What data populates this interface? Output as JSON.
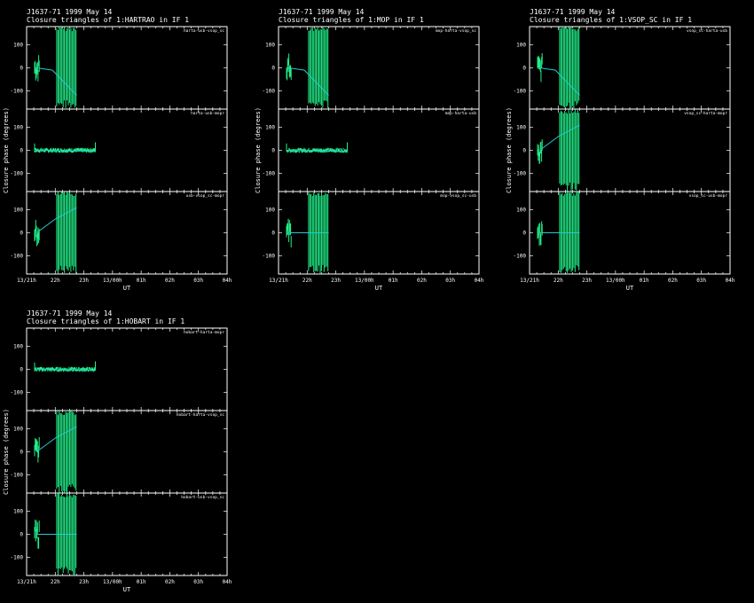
{
  "source": "J1637-71",
  "date": "1999 May 14",
  "colors": {
    "background": "#000000",
    "data": "#22ee88",
    "model": "#22cccc",
    "axes": "#ffffff"
  },
  "chart_data": [
    {
      "type": "scatter",
      "title": "Closure triangles of 1:HARTRAO in IF 1",
      "xlabel": "UT",
      "ylabel": "Closure phase (degrees)",
      "xticks": [
        "13/21h",
        "22h",
        "23h",
        "13/00h",
        "01h",
        "02h",
        "03h",
        "04h"
      ],
      "yticks": [
        -100,
        0,
        100
      ],
      "ylim": [
        -180,
        180
      ],
      "panels": [
        {
          "label": "harta-usb-vsop_sc",
          "model": [
            [
              0.35,
              0
            ],
            [
              0.9,
              -10
            ],
            [
              1.75,
              -120
            ]
          ],
          "data_segments": [
            [
              0.28,
              0.45,
              "noisy"
            ],
            [
              1.05,
              1.75,
              "wrap"
            ]
          ]
        },
        {
          "label": "harta-usb-mopr",
          "model": [
            [
              0.35,
              0
            ],
            [
              2.4,
              -5
            ]
          ],
          "data_segments": [
            [
              0.28,
              2.4,
              "flat"
            ]
          ]
        },
        {
          "label": "usb-vsop_sc-mopr",
          "model": [
            [
              0.35,
              0
            ],
            [
              1.0,
              60
            ],
            [
              1.75,
              110
            ]
          ],
          "data_segments": [
            [
              0.28,
              0.45,
              "noisy"
            ],
            [
              1.05,
              1.75,
              "wrap"
            ]
          ]
        }
      ]
    },
    {
      "type": "scatter",
      "title": "Closure triangles of 1:MOP in IF 1",
      "xlabel": "UT",
      "ylabel": "Closure phase (degrees)",
      "xticks": [
        "13/21h",
        "22h",
        "23h",
        "13/00h",
        "01h",
        "02h",
        "03h",
        "04h"
      ],
      "yticks": [
        -100,
        0,
        100
      ],
      "ylim": [
        -180,
        180
      ],
      "panels": [
        {
          "label": "mop-harta-vsop_sc",
          "model": [
            [
              0.35,
              0
            ],
            [
              0.9,
              -10
            ],
            [
              1.75,
              -120
            ]
          ],
          "data_segments": [
            [
              0.28,
              0.45,
              "noisy"
            ],
            [
              1.05,
              1.75,
              "wrap"
            ]
          ]
        },
        {
          "label": "mop-harta-usb",
          "model": [
            [
              0.35,
              0
            ],
            [
              2.4,
              -5
            ]
          ],
          "data_segments": [
            [
              0.28,
              2.4,
              "flat"
            ]
          ]
        },
        {
          "label": "mop-vsop_sc-usb",
          "model": [
            [
              0.35,
              0
            ],
            [
              1.75,
              0
            ]
          ],
          "data_segments": [
            [
              0.28,
              0.45,
              "noisy"
            ],
            [
              1.05,
              1.75,
              "wrap"
            ]
          ]
        }
      ]
    },
    {
      "type": "scatter",
      "title": "Closure triangles of 1:VSOP_SC in IF 1",
      "xlabel": "UT",
      "ylabel": "Closure phase (degrees)",
      "xticks": [
        "13/21h",
        "22h",
        "23h",
        "13/00h",
        "01h",
        "02h",
        "03h",
        "04h"
      ],
      "yticks": [
        -100,
        0,
        100
      ],
      "ylim": [
        -180,
        180
      ],
      "panels": [
        {
          "label": "vsop_sc-harta-usb",
          "model": [
            [
              0.35,
              0
            ],
            [
              0.9,
              -10
            ],
            [
              1.75,
              -120
            ]
          ],
          "data_segments": [
            [
              0.28,
              0.45,
              "noisy"
            ],
            [
              1.05,
              1.75,
              "wrap"
            ]
          ]
        },
        {
          "label": "vsop_sc-harta-mopr",
          "model": [
            [
              0.35,
              0
            ],
            [
              1.0,
              60
            ],
            [
              1.75,
              110
            ]
          ],
          "data_segments": [
            [
              0.28,
              0.45,
              "noisy"
            ],
            [
              1.05,
              1.75,
              "wrap"
            ]
          ]
        },
        {
          "label": "vsop_sc-usb-mopr",
          "model": [
            [
              0.35,
              0
            ],
            [
              1.75,
              0
            ]
          ],
          "data_segments": [
            [
              0.28,
              0.45,
              "noisy"
            ],
            [
              1.05,
              1.75,
              "wrap"
            ]
          ]
        }
      ]
    },
    {
      "type": "scatter",
      "title": "Closure triangles of 1:HOBART in IF 1",
      "xlabel": "UT",
      "ylabel": "Closure phase (degrees)",
      "xticks": [
        "13/21h",
        "22h",
        "23h",
        "13/00h",
        "01h",
        "02h",
        "03h",
        "04h"
      ],
      "yticks": [
        -100,
        0,
        100
      ],
      "ylim": [
        -180,
        180
      ],
      "panels": [
        {
          "label": "hobart-harta-mopr",
          "model": [
            [
              0.35,
              0
            ],
            [
              2.4,
              -5
            ]
          ],
          "data_segments": [
            [
              0.28,
              2.4,
              "flat"
            ]
          ]
        },
        {
          "label": "hobart-harta-vsop_sc",
          "model": [
            [
              0.35,
              0
            ],
            [
              1.0,
              60
            ],
            [
              1.75,
              110
            ]
          ],
          "data_segments": [
            [
              0.28,
              0.45,
              "noisy"
            ],
            [
              1.05,
              1.75,
              "wrap"
            ]
          ]
        },
        {
          "label": "hobart-usb-vsop_sc",
          "model": [
            [
              0.35,
              0
            ],
            [
              1.75,
              0
            ]
          ],
          "data_segments": [
            [
              0.28,
              0.45,
              "noisy"
            ],
            [
              1.05,
              1.75,
              "wrap"
            ]
          ]
        }
      ]
    }
  ]
}
